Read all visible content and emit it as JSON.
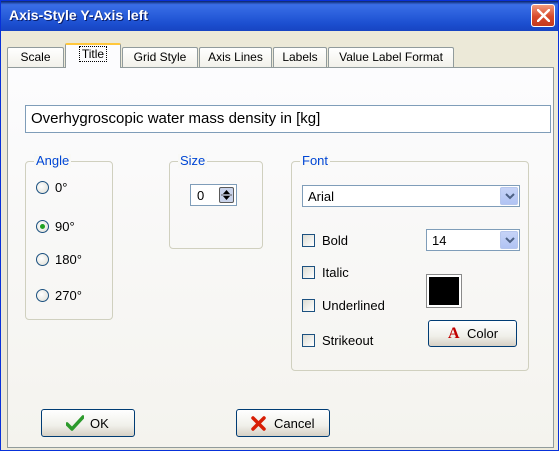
{
  "window": {
    "title": "Axis-Style Y-Axis left"
  },
  "tabs": [
    {
      "label": "Scale"
    },
    {
      "label": "Title"
    },
    {
      "label": "Grid Style"
    },
    {
      "label": "Axis Lines"
    },
    {
      "label": "Labels"
    },
    {
      "label": "Value Label Format"
    }
  ],
  "active_tab": "Title",
  "title_text": "Overhygroscopic water mass density in [kg]",
  "angle": {
    "label": "Angle",
    "options": [
      {
        "label": "0°",
        "selected": false
      },
      {
        "label": "90°",
        "selected": true
      },
      {
        "label": "180°",
        "selected": false
      },
      {
        "label": "270°",
        "selected": false
      }
    ]
  },
  "size": {
    "label": "Size",
    "value": "0"
  },
  "font": {
    "label": "Font",
    "family_value": "Arial",
    "size_value": "14",
    "bold_label": "Bold",
    "italic_label": "Italic",
    "underlined_label": "Underlined",
    "strikeout_label": "Strikeout",
    "color_button_label": "Color",
    "color_swatch": "#000000"
  },
  "buttons": {
    "ok_label": "OK",
    "cancel_label": "Cancel"
  },
  "colors": {
    "titlebar": "#2a5fdc",
    "group_label": "#0046d5",
    "selected_radio": "#21a121",
    "ok_check": "#2c9a2c",
    "cancel_x": "#d81e05",
    "color_a": "#c00000"
  },
  "icons": {
    "close": "close-icon",
    "ok": "checkmark-icon",
    "cancel": "red-x-icon",
    "color": "letter-a-icon"
  }
}
